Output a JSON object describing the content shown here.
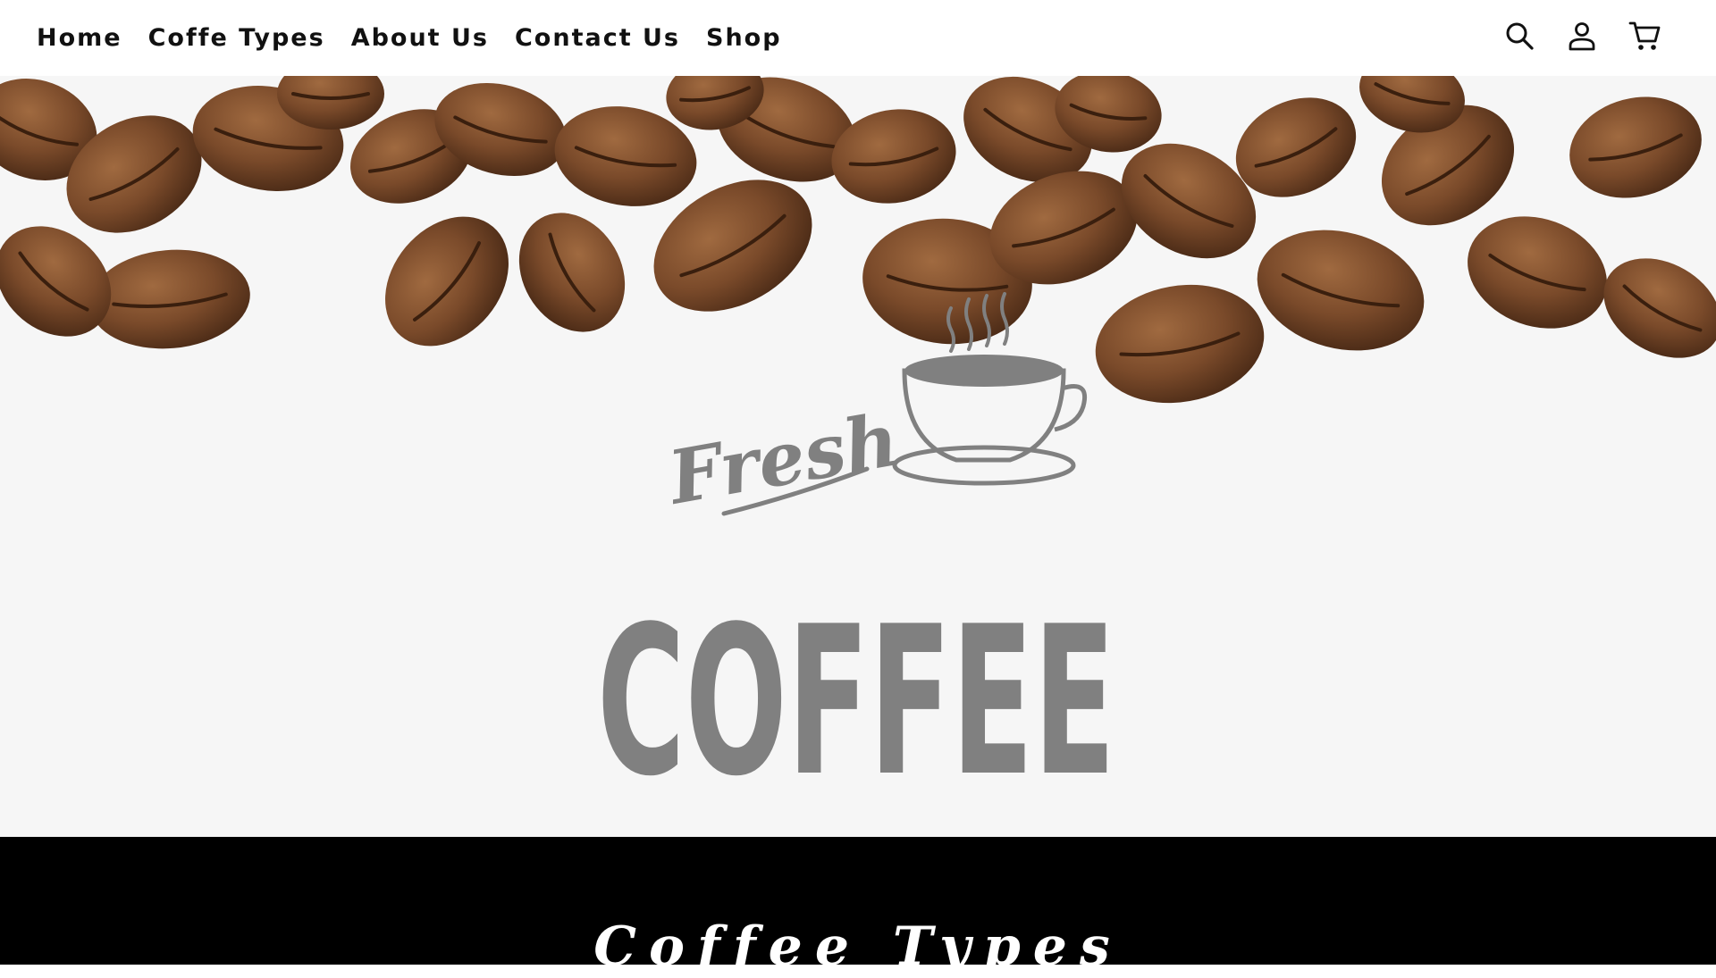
{
  "nav": {
    "links": [
      {
        "label": "Home"
      },
      {
        "label": "Coffe Types"
      },
      {
        "label": "About Us"
      },
      {
        "label": "Contact Us"
      },
      {
        "label": "Shop"
      }
    ],
    "icons": [
      "search-icon",
      "account-icon",
      "cart-icon"
    ]
  },
  "hero": {
    "logo_script": "Fresh",
    "logo_main": "COFFEE",
    "background_color": "#f6f6f6",
    "bean_color": "#7a4a2a",
    "logo_color": "#808080"
  },
  "section": {
    "title": "Coffee Types",
    "background_color": "#000000"
  }
}
